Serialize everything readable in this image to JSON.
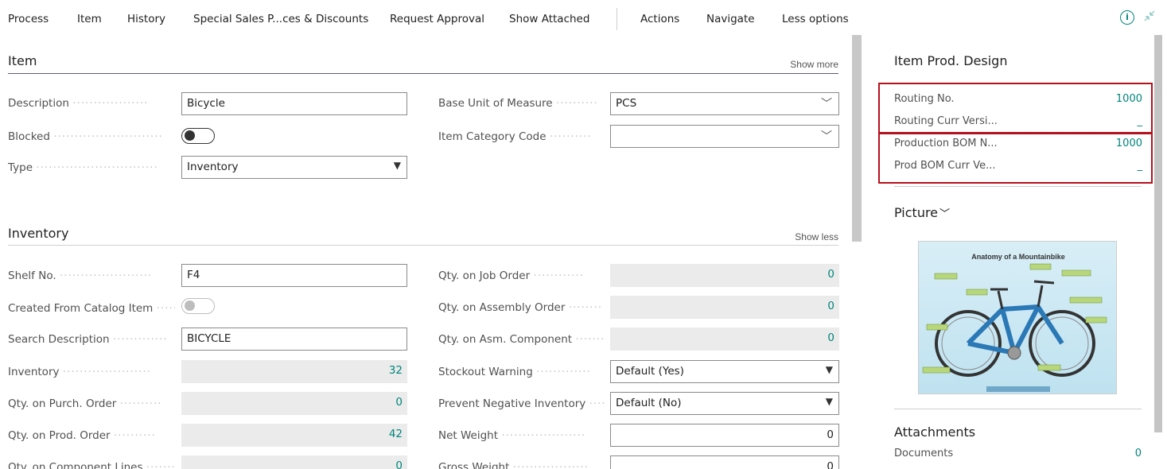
{
  "actions": [
    "Process",
    "Item",
    "History",
    "Special Sales P...ces & Discounts",
    "Request Approval",
    "Show Attached",
    "Actions",
    "Navigate",
    "Less options"
  ],
  "item_section": {
    "title": "Item",
    "toggle": "Show more",
    "fields": {
      "description": {
        "label": "Description",
        "value": "Bicycle"
      },
      "blocked": {
        "label": "Blocked",
        "value": false
      },
      "type": {
        "label": "Type",
        "value": "Inventory"
      },
      "base_uom": {
        "label": "Base Unit of Measure",
        "value": "PCS"
      },
      "item_category": {
        "label": "Item Category Code",
        "value": ""
      }
    }
  },
  "inventory_section": {
    "title": "Inventory",
    "toggle": "Show less",
    "left": [
      {
        "label": "Shelf No.",
        "value": "F4",
        "kind": "input"
      },
      {
        "label": "Created From Catalog Item",
        "value": "",
        "kind": "toggle"
      },
      {
        "label": "Search Description",
        "value": "BICYCLE",
        "kind": "input"
      },
      {
        "label": "Inventory",
        "value": "32",
        "kind": "ro"
      },
      {
        "label": "Qty. on Purch. Order",
        "value": "0",
        "kind": "ro"
      },
      {
        "label": "Qty. on Prod. Order",
        "value": "42",
        "kind": "ro"
      },
      {
        "label": "Qty. on Component Lines",
        "value": "0",
        "kind": "ro"
      }
    ],
    "right": [
      {
        "label": "Qty. on Job Order",
        "value": "0",
        "kind": "ro"
      },
      {
        "label": "Qty. on Assembly Order",
        "value": "0",
        "kind": "ro"
      },
      {
        "label": "Qty. on Asm. Component",
        "value": "0",
        "kind": "ro"
      },
      {
        "label": "Stockout Warning",
        "value": "Default (Yes)",
        "kind": "select"
      },
      {
        "label": "Prevent Negative Inventory",
        "value": "Default (No)",
        "kind": "select"
      },
      {
        "label": "Net Weight",
        "value": "0",
        "kind": "input-num"
      },
      {
        "label": "Gross Weight",
        "value": "0",
        "kind": "input-num"
      }
    ]
  },
  "factbox": {
    "prod_design": {
      "title": "Item Prod. Design",
      "rows": [
        {
          "label": "Routing No.",
          "value": "1000"
        },
        {
          "label": "Routing Curr Versi...",
          "value": "_"
        },
        {
          "label": "Production BOM N...",
          "value": "1000"
        },
        {
          "label": "Prod BOM Curr Ve...",
          "value": "_"
        }
      ]
    },
    "picture": {
      "title": "Picture",
      "caption": "Anatomy of a Mountainbike"
    },
    "attachments": {
      "title": "Attachments",
      "rows": [
        {
          "label": "Documents",
          "value": "0"
        }
      ]
    }
  },
  "colors": {
    "accent": "#00857b",
    "highlight": "#b5111d"
  }
}
